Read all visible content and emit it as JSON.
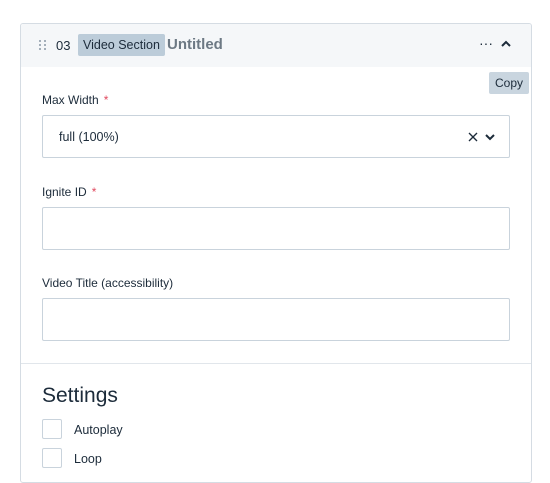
{
  "block": {
    "number": "03",
    "type_label": "Video Section",
    "title": "Untitled",
    "copy_label": "Copy"
  },
  "icons": {
    "drag": "drag-handle-icon",
    "menu": "more-horizontal-icon",
    "collapse": "chevron-up-icon",
    "clear": "close-icon",
    "dropdown": "chevron-down-icon"
  },
  "fields": {
    "max_width": {
      "label": "Max Width",
      "required": "*",
      "value": "full (100%)"
    },
    "ignite_id": {
      "label": "Ignite ID",
      "required": "*",
      "value": ""
    },
    "video_title": {
      "label": "Video Title (accessibility)",
      "value": ""
    }
  },
  "settings": {
    "title": "Settings",
    "options": [
      {
        "label": "Autoplay",
        "checked": false
      },
      {
        "label": "Loop",
        "checked": false
      }
    ]
  },
  "colors": {
    "required": "#e0485e",
    "header_bg": "#f5f7f9",
    "tag_bg": "#bcccd9",
    "copy_bg": "#c9d5df"
  }
}
